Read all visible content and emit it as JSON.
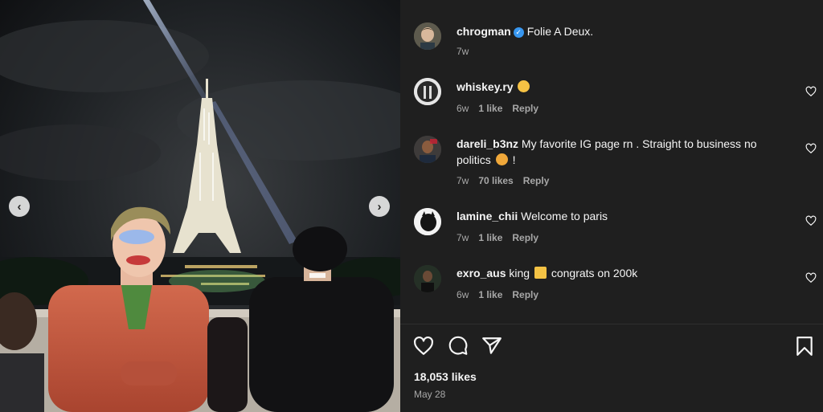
{
  "photo": {
    "prev_icon": "chevron-left-icon",
    "next_icon": "chevron-right-icon"
  },
  "post": {
    "author": "chrogman",
    "verified": true,
    "caption": "Folie A Deux.",
    "time": "7w"
  },
  "comments": [
    {
      "user": "whiskey.ry",
      "text": "",
      "emoji": "clapping-hands",
      "time": "6w",
      "likes": "1 like",
      "reply": "Reply"
    },
    {
      "user": "dareli_b3nz",
      "text_line1": "My favorite IG page rn . Straight to business no",
      "text_line2_a": "politics",
      "text_line2_b": "!",
      "emoji": "face-emoji",
      "time": "7w",
      "likes": "70 likes",
      "reply": "Reply"
    },
    {
      "user": "lamine_chii",
      "text": "Welcome to paris",
      "time": "7w",
      "likes": "1 like",
      "reply": "Reply"
    },
    {
      "user": "exro_aus",
      "text_a": "king",
      "text_b": "congrats on 200k",
      "emoji": "crown",
      "time": "6w",
      "likes": "1 like",
      "reply": "Reply"
    }
  ],
  "actions": {
    "like_icon": "heart-icon",
    "comment_icon": "comment-icon",
    "share_icon": "send-icon",
    "save_icon": "bookmark-icon"
  },
  "stats": {
    "likes": "18,053 likes",
    "date": "May 28"
  },
  "colors": {
    "panel_bg": "#1f1f1f",
    "text": "#f5f5f5",
    "muted": "#a8a8a8",
    "verified": "#3897f0"
  }
}
